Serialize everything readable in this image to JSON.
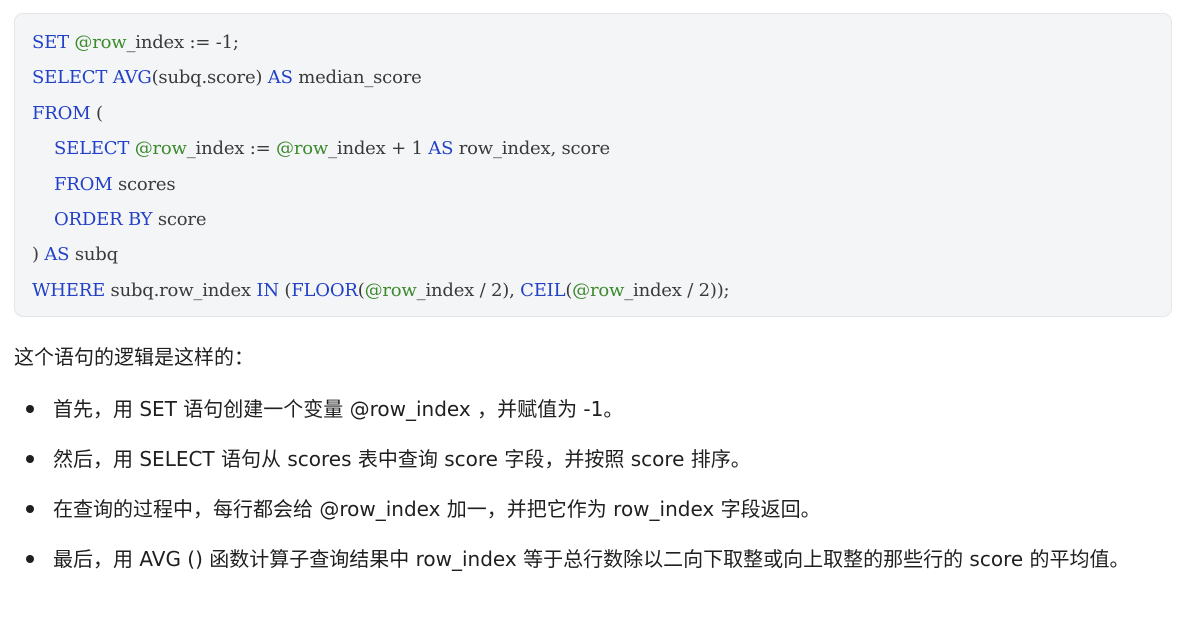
{
  "code": {
    "lines": [
      {
        "indent": false,
        "tokens": [
          {
            "t": "SET",
            "c": "kw"
          },
          {
            "t": " ",
            "c": "plain"
          },
          {
            "t": "@row",
            "c": "var"
          },
          {
            "t": "_index := -1;",
            "c": "plain"
          }
        ]
      },
      {
        "indent": false,
        "tokens": [
          {
            "t": "SELECT",
            "c": "kw"
          },
          {
            "t": " ",
            "c": "plain"
          },
          {
            "t": "AVG",
            "c": "kw"
          },
          {
            "t": "(subq.score) ",
            "c": "plain"
          },
          {
            "t": "AS",
            "c": "kw"
          },
          {
            "t": " median_score",
            "c": "plain"
          }
        ]
      },
      {
        "indent": false,
        "tokens": [
          {
            "t": "FROM",
            "c": "kw"
          },
          {
            "t": " (",
            "c": "plain"
          }
        ]
      },
      {
        "indent": true,
        "tokens": [
          {
            "t": "SELECT",
            "c": "kw"
          },
          {
            "t": " ",
            "c": "plain"
          },
          {
            "t": "@row",
            "c": "var"
          },
          {
            "t": "_index := ",
            "c": "plain"
          },
          {
            "t": "@row",
            "c": "var"
          },
          {
            "t": "_index + 1 ",
            "c": "plain"
          },
          {
            "t": "AS",
            "c": "kw"
          },
          {
            "t": " row_index, score",
            "c": "plain"
          }
        ]
      },
      {
        "indent": true,
        "tokens": [
          {
            "t": "FROM",
            "c": "kw"
          },
          {
            "t": " scores",
            "c": "plain"
          }
        ]
      },
      {
        "indent": true,
        "tokens": [
          {
            "t": "ORDER BY",
            "c": "kw"
          },
          {
            "t": " score",
            "c": "plain"
          }
        ]
      },
      {
        "indent": false,
        "tokens": [
          {
            "t": ") ",
            "c": "plain"
          },
          {
            "t": "AS",
            "c": "kw"
          },
          {
            "t": " subq",
            "c": "plain"
          }
        ]
      },
      {
        "indent": false,
        "tokens": [
          {
            "t": "WHERE",
            "c": "kw"
          },
          {
            "t": " subq.row_index ",
            "c": "plain"
          },
          {
            "t": "IN",
            "c": "kw"
          },
          {
            "t": " (",
            "c": "plain"
          },
          {
            "t": "FLOOR",
            "c": "kw"
          },
          {
            "t": "(",
            "c": "plain"
          },
          {
            "t": "@row",
            "c": "var"
          },
          {
            "t": "_index / 2), ",
            "c": "plain"
          },
          {
            "t": "CEIL",
            "c": "kw"
          },
          {
            "t": "(",
            "c": "plain"
          },
          {
            "t": "@row",
            "c": "var"
          },
          {
            "t": "_index / 2));",
            "c": "plain"
          }
        ]
      }
    ]
  },
  "explanation": {
    "intro": "这个语句的逻辑是这样的：",
    "bullets": [
      "首先，用 SET 语句创建一个变量 @row_index ，并赋值为 -1。",
      "然后，用 SELECT 语句从 scores 表中查询 score 字段，并按照 score 排序。",
      "在查询的过程中，每行都会给 @row_index 加一，并把它作为 row_index 字段返回。",
      "最后，用 AVG () 函数计算子查询结果中 row_index 等于总行数除以二向下取整或向上取整的那些行的 score 的平均值。"
    ]
  },
  "colors": {
    "keyword": "#2341c7",
    "variable": "#3b8a2c",
    "code_text": "#3a3a3a",
    "code_background": "#f4f5f7",
    "body_text": "#1f1f1f"
  }
}
